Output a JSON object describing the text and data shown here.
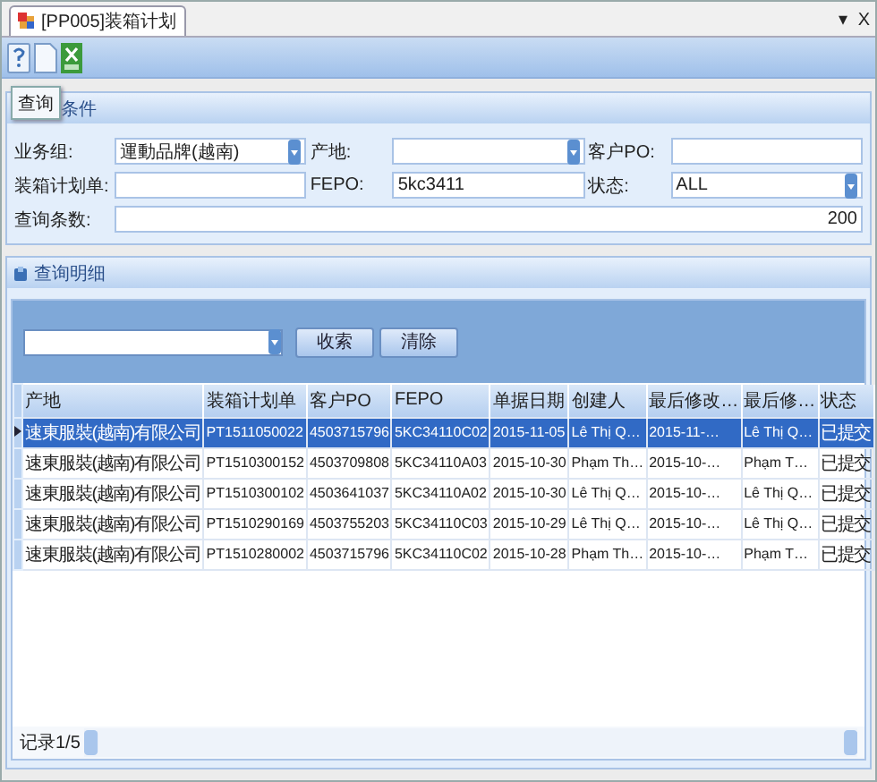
{
  "tab": {
    "title": "[PP005]装箱计划",
    "selected": true
  },
  "window_controls": [
    "▾",
    "X"
  ],
  "query_panel": {
    "tooltip": "查询",
    "title": "条件",
    "fields": [
      {
        "label": "业务组:",
        "kind": "combo",
        "value": "運動品牌(越南)"
      },
      {
        "label": "产地:",
        "kind": "combo"
      },
      {
        "label": "客户PO:",
        "kind": "text"
      },
      {
        "label": "装箱计划单:",
        "kind": "text"
      },
      {
        "label": "FEPO:",
        "kind": "text",
        "value": "5kc3411"
      },
      {
        "label": "状态:",
        "kind": "combo",
        "value": "ALL"
      },
      {
        "label": "查询条数:",
        "kind": "number",
        "value": "200"
      }
    ]
  },
  "detail_panel": {
    "title": "查询明细",
    "search_buttons": [
      "收索",
      "清除"
    ],
    "table": {
      "columns": [
        "产地",
        "装箱计划单",
        "客户PO",
        "FEPO",
        "单据日期",
        "创建人",
        "最后修改…",
        "最后修…",
        "状态"
      ],
      "rows": [
        {
          "selected": true,
          "cells": [
            "速東服裝(越南)有限公司",
            "PT1511050022",
            "4503715796",
            "5KC34110C02",
            "2015-11-05",
            "Lê Thị Q…",
            "2015-11-…",
            "Lê Thị Q…",
            "已提交"
          ]
        },
        {
          "selected": false,
          "cells": [
            "速東服裝(越南)有限公司",
            "PT1510300152",
            "4503709808",
            "5KC34110A03",
            "2015-10-30",
            "Phạm Th…",
            "2015-10-…",
            "Phạm T…",
            "已提交"
          ]
        },
        {
          "selected": false,
          "cells": [
            "速東服裝(越南)有限公司",
            "PT1510300102",
            "4503641037",
            "5KC34110A02",
            "2015-10-30",
            "Lê Thị Q…",
            "2015-10-…",
            "Lê Thị Q…",
            "已提交"
          ]
        },
        {
          "selected": false,
          "cells": [
            "速東服裝(越南)有限公司",
            "PT1510290169",
            "4503755203",
            "5KC34110C03",
            "2015-10-29",
            "Lê Thị Q…",
            "2015-10-…",
            "Lê Thị Q…",
            "已提交"
          ]
        },
        {
          "selected": false,
          "cells": [
            "速東服裝(越南)有限公司",
            "PT1510280002",
            "4503715796",
            "5KC34110C02",
            "2015-10-28",
            "Phạm Th…",
            "2015-10-…",
            "Phạm T…",
            "已提交"
          ]
        }
      ]
    },
    "record_label": "记录1/5"
  }
}
